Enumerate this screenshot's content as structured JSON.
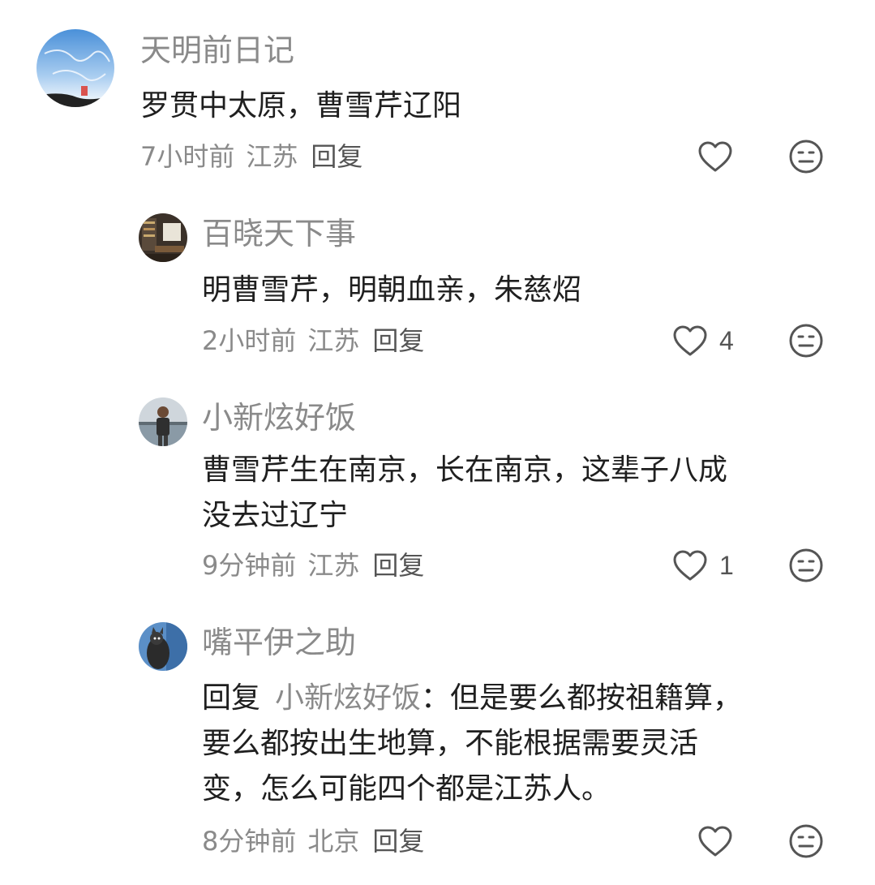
{
  "comments": [
    {
      "username": "天明前日记",
      "content": "罗贯中太原，曹雪芹辽阳",
      "time": "7小时前",
      "location": "江苏",
      "reply_label": "回复",
      "likes": ""
    },
    {
      "username": "百晓天下事",
      "content": "明曹雪芹，明朝血亲，朱慈炤",
      "time": "2小时前",
      "location": "江苏",
      "reply_label": "回复",
      "likes": "4"
    },
    {
      "username": "小新炫好饭",
      "content_line1": "曹雪芹生在南京，长在南京，这辈子八成",
      "content_line2": "没去过辽宁",
      "time": "9分钟前",
      "location": "江苏",
      "reply_label": "回复",
      "likes": "1"
    },
    {
      "username": "嘴平伊之助",
      "reply_prefix": "回复",
      "reply_target": "小新炫好饭",
      "content_line1": "：但是要么都按祖籍算，",
      "content_line2": "要么都按出生地算，不能根据需要灵活",
      "content_line3": "变，怎么可能四个都是江苏人。",
      "time": "8分钟前",
      "location": "北京",
      "reply_label": "回复",
      "likes": ""
    }
  ],
  "colors": {
    "username": "#8a8a8a",
    "text": "#1f1f1f",
    "meta": "#8a8a8a",
    "icon": "#555555"
  },
  "icons": {
    "like": "heart-outline-icon",
    "dislike": "meh-face-icon"
  }
}
